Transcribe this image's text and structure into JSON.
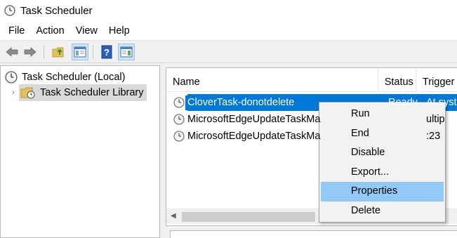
{
  "window": {
    "title": "Task Scheduler"
  },
  "menubar": {
    "items": [
      "File",
      "Action",
      "View",
      "Help"
    ]
  },
  "toolbar": {
    "icons": [
      "back-arrow-icon",
      "forward-arrow-icon",
      "folder-up-icon",
      "show-hide-console-tree-icon",
      "help-icon",
      "show-hide-action-pane-icon"
    ]
  },
  "tree": {
    "root_label": "Task Scheduler (Local)",
    "child_label": "Task Scheduler Library",
    "child_expander": "›"
  },
  "list": {
    "columns": [
      "Name",
      "Status",
      "Trigger"
    ],
    "rows": [
      {
        "name": "CloverTask-donotdelete",
        "status": "Ready",
        "trigger": "At syst",
        "selected": true
      },
      {
        "name": "MicrosoftEdgeUpdateTaskMa",
        "status": "",
        "trigger": "ultip",
        "selected": false
      },
      {
        "name": "MicrosoftEdgeUpdateTaskMa",
        "status": "",
        "trigger": ":23",
        "selected": false
      }
    ]
  },
  "context_menu": {
    "items": [
      "Run",
      "End",
      "Disable",
      "Export...",
      "Properties",
      "Delete"
    ],
    "highlighted": "Properties"
  },
  "colors": {
    "selection": "#0078d7",
    "menu_hover": "#91c9f7"
  }
}
